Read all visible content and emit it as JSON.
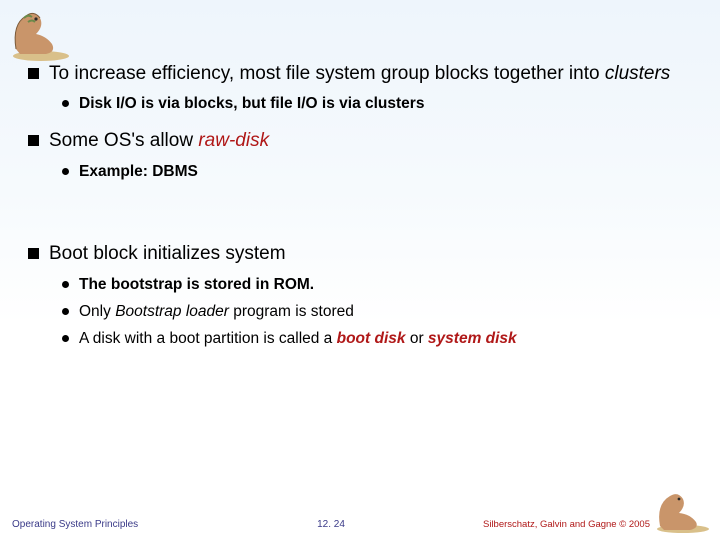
{
  "bullets": {
    "b1_a": "To increase efficiency, most file system group blocks together into ",
    "b1_b": "clusters",
    "b1_1": "Disk I/O is via blocks, but file I/O is via clusters",
    "b2_a": "Some OS's allow ",
    "b2_b": "raw-disk",
    "b2_1": "Example: DBMS",
    "b3": "Boot block initializes system",
    "b3_1": "The bootstrap is stored in ROM.",
    "b3_2a": "Only ",
    "b3_2b": "Bootstrap loader",
    "b3_2c": " program is stored",
    "b3_3a": "A disk with a boot partition is called a ",
    "b3_3b": "boot disk",
    "b3_3c": " or ",
    "b3_3d": "system disk"
  },
  "footer": {
    "left": "Operating System Principles",
    "center": "12. 24",
    "right": "Silberschatz, Galvin and Gagne © 2005"
  }
}
